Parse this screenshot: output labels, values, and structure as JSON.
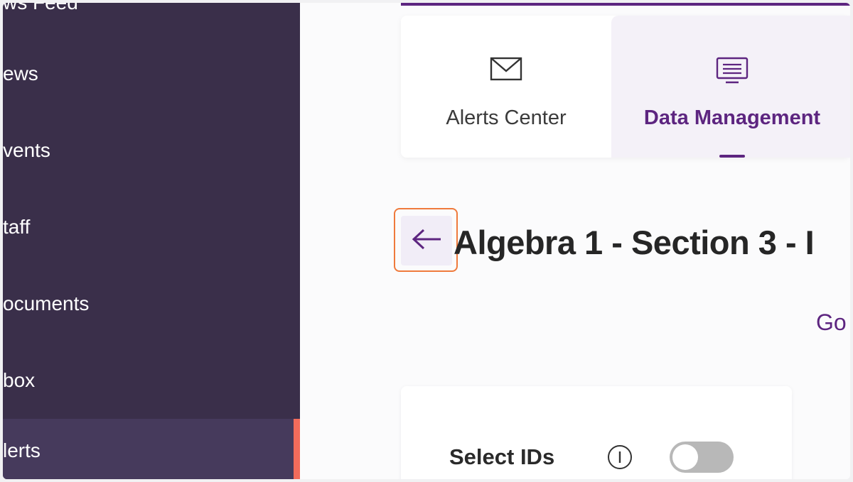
{
  "sidebar": {
    "items": [
      {
        "label": "ws Feed"
      },
      {
        "label": "ews"
      },
      {
        "label": "vents"
      },
      {
        "label": "taff"
      },
      {
        "label": "ocuments"
      },
      {
        "label": "box"
      },
      {
        "label": "lerts",
        "active": true
      }
    ],
    "active_accent": "#f26b5b",
    "background": "#3a2f4a"
  },
  "tabs": [
    {
      "label": "Alerts Center",
      "icon": "envelope-icon"
    },
    {
      "label": "Data Management",
      "icon": "monitor-list-icon",
      "active": true
    }
  ],
  "header": {
    "back_icon": "arrow-left-icon",
    "title": "Algebra 1 - Section 3 - I"
  },
  "go_link": "Go",
  "select_ids": {
    "label": "Select IDs",
    "info_icon": "info-icon",
    "toggle_on": false
  },
  "accent": "#5d2580"
}
